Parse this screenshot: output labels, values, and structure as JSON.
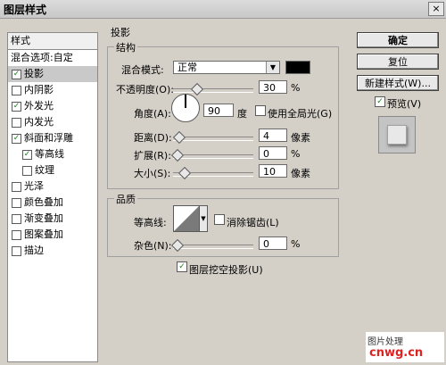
{
  "window": {
    "title": "图层样式",
    "close_label": "×"
  },
  "styles_panel": {
    "header": "样式",
    "blend_item": "混合选项:自定",
    "items": [
      {
        "label": "投影",
        "checked": true,
        "selected": true
      },
      {
        "label": "内阴影",
        "checked": false
      },
      {
        "label": "外发光",
        "checked": true
      },
      {
        "label": "内发光",
        "checked": false
      },
      {
        "label": "斜面和浮雕",
        "checked": true
      },
      {
        "label": "等高线",
        "checked": true,
        "sub": true
      },
      {
        "label": "纹理",
        "checked": false,
        "sub": true
      },
      {
        "label": "光泽",
        "checked": false
      },
      {
        "label": "颜色叠加",
        "checked": false
      },
      {
        "label": "渐变叠加",
        "checked": false
      },
      {
        "label": "图案叠加",
        "checked": false
      },
      {
        "label": "描边",
        "checked": false
      }
    ]
  },
  "drop_shadow": {
    "section_title": "投影",
    "structure_title": "结构",
    "blend_mode_label": "混合模式:",
    "blend_mode_value": "正常",
    "shadow_color": "#000000",
    "opacity_label": "不透明度(O):",
    "opacity_value": "30",
    "opacity_unit": "%",
    "angle_label": "角度(A):",
    "angle_value": "90",
    "angle_unit": "度",
    "global_light_label": "使用全局光(G)",
    "global_light_checked": false,
    "distance_label": "距离(D):",
    "distance_value": "4",
    "distance_unit": "像素",
    "spread_label": "扩展(R):",
    "spread_value": "0",
    "spread_unit": "%",
    "size_label": "大小(S):",
    "size_value": "10",
    "size_unit": "像素",
    "quality_title": "品质",
    "contour_label": "等高线:",
    "antialias_label": "消除锯齿(L)",
    "antialias_checked": false,
    "noise_label": "杂色(N):",
    "noise_value": "0",
    "noise_unit": "%",
    "knockout_label": "图层挖空投影(U)",
    "knockout_checked": true
  },
  "buttons": {
    "ok": "确定",
    "reset": "复位",
    "new_style": "新建样式(W)...",
    "preview_label": "预览(V)",
    "preview_checked": true
  },
  "watermark": {
    "text": "cnwg.cn",
    "caption": "图片处理"
  }
}
